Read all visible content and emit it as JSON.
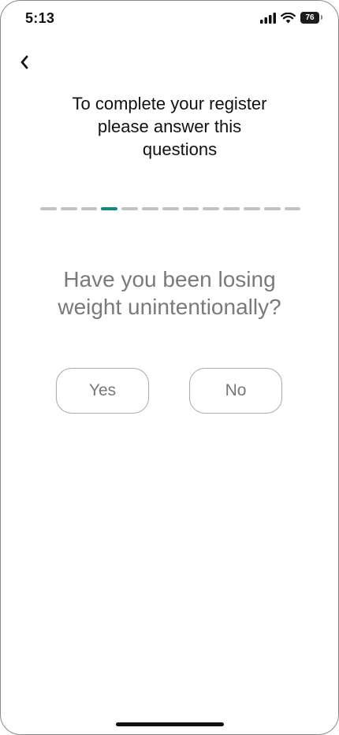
{
  "status_bar": {
    "time": "5:13",
    "battery_level": "76",
    "icons": [
      "cellular-signal-icon",
      "wifi-icon",
      "battery-icon"
    ]
  },
  "nav": {
    "back_icon": "chevron-left-icon"
  },
  "header": {
    "title_line1": "To complete your register",
    "title_line2": "please answer this",
    "title_line3": "questions"
  },
  "progress": {
    "total_steps": 13,
    "current_step": 4,
    "active_color": "#14877e",
    "inactive_color": "#c2c2c2"
  },
  "question": {
    "line1": "Have you been losing",
    "line2": "weight unintentionally?"
  },
  "answers": {
    "yes_label": "Yes",
    "no_label": "No"
  }
}
